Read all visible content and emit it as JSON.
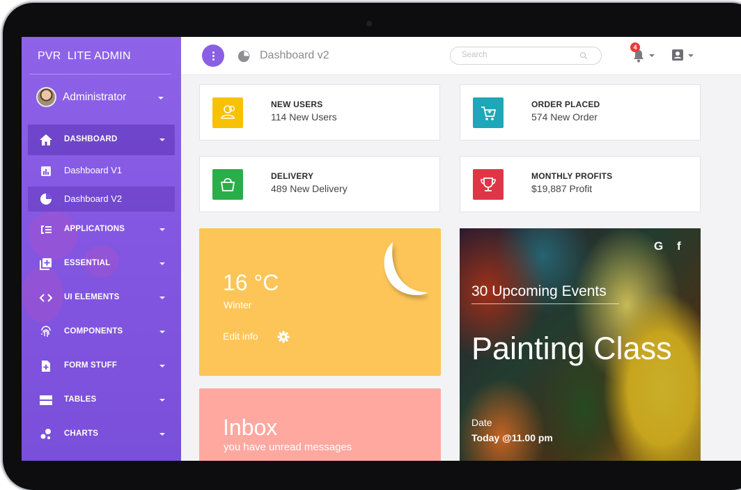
{
  "sidebar": {
    "brand": "PVR  LITE ADMIN",
    "user_name": "Administrator",
    "items": [
      {
        "label": "DASHBOARD",
        "icon": "home-icon"
      },
      {
        "label": "Dashboard V1",
        "icon": "bar-chart-icon"
      },
      {
        "label": "Dashboard V2",
        "icon": "pie-chart-icon"
      },
      {
        "label": "APPLICATIONS",
        "icon": "list-icon"
      },
      {
        "label": "ESSENTIAL",
        "icon": "add-box-icon"
      },
      {
        "label": "UI ELEMENTS",
        "icon": "code-icon"
      },
      {
        "label": "COMPONENTS",
        "icon": "fingerprint-icon"
      },
      {
        "label": "FORM STUFF",
        "icon": "document-add-icon"
      },
      {
        "label": "TABLES",
        "icon": "table-icon"
      },
      {
        "label": "CHARTS",
        "icon": "bubble-chart-icon"
      }
    ]
  },
  "topbar": {
    "title": "Dashboard v2",
    "search_placeholder": "Search",
    "notification_count": "4"
  },
  "stats": [
    {
      "title": "NEW USERS",
      "value": "114 New Users",
      "color": "#f7c204",
      "icon": "users-icon"
    },
    {
      "title": "ORDER PLACED",
      "value": "574 New Order",
      "color": "#1ea7b8",
      "icon": "cart-icon"
    },
    {
      "title": "DELIVERY",
      "value": "489 New Delivery",
      "color": "#29ae4a",
      "icon": "bag-icon"
    },
    {
      "title": "MONTHLY PROFITS",
      "value": "$19,887 Profit",
      "color": "#e03546",
      "icon": "trophy-icon"
    }
  ],
  "weather": {
    "temp": "16 °C",
    "season": "Winter",
    "edit_label": "Edit info",
    "color": "#fdc558"
  },
  "inbox": {
    "title": "Inbox",
    "subtitle": "you have unread messages",
    "color": "#ffa8a0"
  },
  "event": {
    "google": "G",
    "facebook": "f",
    "upcoming": "30 Upcoming Events",
    "title": "Painting Class",
    "date_label": "Date",
    "date_value": "Today @11.00 pm"
  },
  "colors": {
    "accent": "#8a5fe4",
    "sidebar_top": "#8e63e8",
    "sidebar_bottom": "#7a4fd9",
    "badge": "#ea3a3a"
  }
}
